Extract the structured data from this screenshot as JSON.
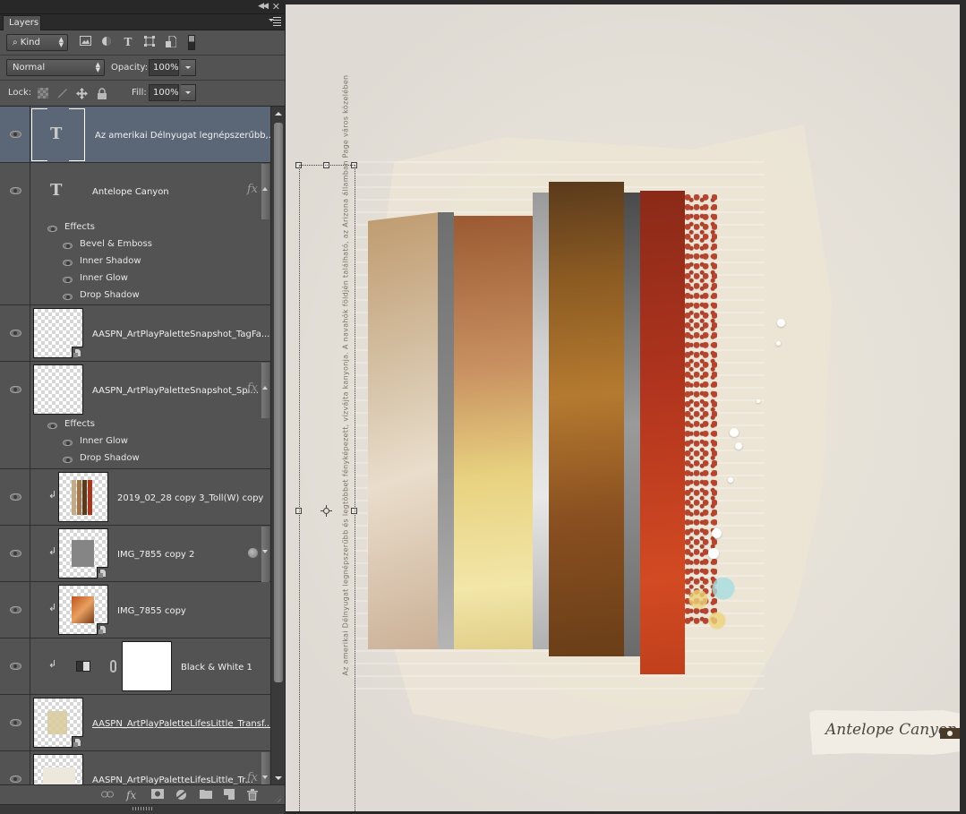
{
  "panel": {
    "tab_label": "Layers",
    "collapse_icon": "double-chevron-left-icon",
    "close_icon": "close-icon",
    "menu_icon": "panel-menu-icon",
    "filter": {
      "kind_label": "Kind",
      "icons": [
        "pixel-layer-filter-icon",
        "adjustment-layer-filter-icon",
        "type-layer-filter-icon",
        "shape-layer-filter-icon",
        "smart-object-filter-icon",
        "filter-toggle-icon"
      ]
    },
    "blend_mode": "Normal",
    "opacity_label": "Opacity:",
    "opacity_value": "100%",
    "lock_label": "Lock:",
    "fill_label": "Fill:",
    "fill_value": "100%",
    "lock_icons": [
      "lock-transparent-pixels-icon",
      "lock-image-pixels-icon",
      "lock-position-icon",
      "lock-all-icon"
    ]
  },
  "layers": [
    {
      "name": "Az amerikai Délnyugat legnépszerűbb,...",
      "type": "text",
      "selected": true
    },
    {
      "name": "Antelope Canyon",
      "type": "text",
      "fx": true,
      "effects_label": "Effects",
      "effects": [
        "Bevel & Emboss",
        "Inner Shadow",
        "Inner Glow",
        "Drop Shadow"
      ]
    },
    {
      "name": "AASPN_ArtPlayPaletteSnapshot_TagFa...",
      "type": "smart-object"
    },
    {
      "name": "AASPN_ArtPlayPaletteSnapshot_Spl...",
      "type": "smart-object",
      "fx": true,
      "effects_label": "Effects",
      "effects": [
        "Inner Glow",
        "Drop Shadow"
      ]
    },
    {
      "name": "2019_02_28 copy 3_Toll(W) copy",
      "type": "pixel",
      "clipped": true
    },
    {
      "name": "IMG_7855 copy 2",
      "type": "smart-object",
      "clipped": true,
      "smart_filter": true
    },
    {
      "name": "IMG_7855 copy",
      "type": "smart-object",
      "clipped": true
    },
    {
      "name": "Black & White 1",
      "type": "adjustment",
      "clipped": true
    },
    {
      "name": "AASPN_ArtPlayPaletteLifesLittle_Transf...",
      "type": "smart-object"
    },
    {
      "name": "AASPN_ArtPlayPaletteLifesLittle_Tr...",
      "type": "smart-object",
      "fx": true
    }
  ],
  "bottom_bar": {
    "icons": [
      "link-layers-icon",
      "add-layer-style-icon",
      "add-mask-icon",
      "new-adjustment-layer-icon",
      "new-group-icon",
      "new-layer-icon",
      "delete-layer-icon"
    ]
  },
  "canvas": {
    "vertical_text": "Az amerikai Délnyugat legnépszerűbb és legtöbbet fényképezett, vízvájta kanyonja. A navahók földjén található, az Arizona államban Page város közelében",
    "tag_text": "Antelope Canyon",
    "colors": {
      "paper": "#e6e1d8",
      "rust": "#b8391f",
      "ochre": "#8a5a1e",
      "sand": "#c9a57a",
      "gray_strip": "#8f8f8f"
    }
  }
}
